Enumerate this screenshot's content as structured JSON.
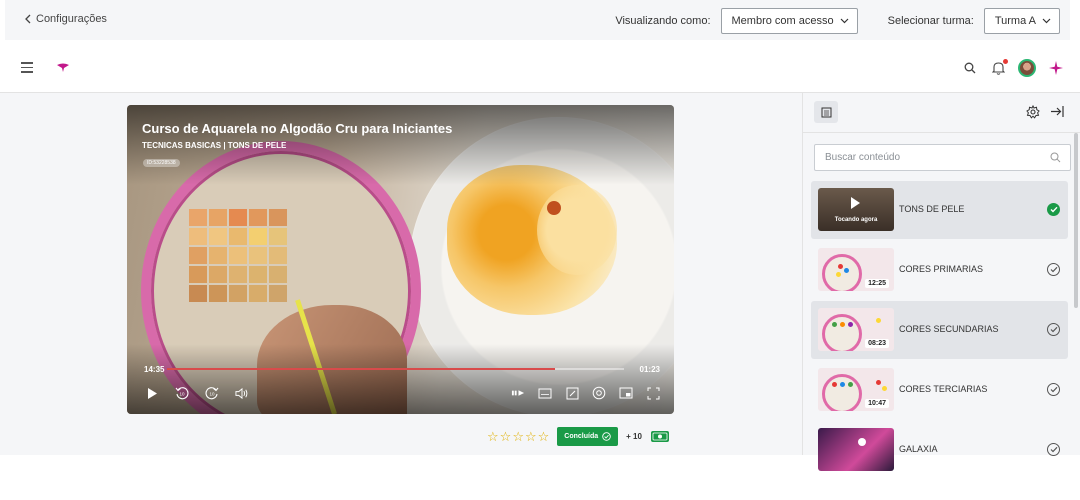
{
  "config_bar": {
    "back_label": "Configurações",
    "viewing_as_label": "Visualizando como:",
    "viewing_as_value": "Membro com acesso",
    "select_class_label": "Selecionar turma:",
    "select_class_value": "Turma A"
  },
  "header": {
    "icons": [
      "menu-icon",
      "logo",
      "search-icon",
      "bell-icon",
      "avatar",
      "sparkle-icon"
    ],
    "accent_color": "#c2188b"
  },
  "video": {
    "title": "Curso de Aquarela no Algodão Cru para Iniciantes",
    "subtitle": "TECNICAS BASICAS | TONS DE PELE",
    "id_badge": "ID:53228538",
    "time_current": "14:35",
    "time_remaining": "01:23",
    "progress": 0.85,
    "controls_left": [
      "play-icon",
      "rewind-10-icon",
      "forward-10-icon",
      "volume-icon"
    ],
    "controls_right": [
      "speed-icon",
      "subtitles-icon",
      "edit-icon",
      "record-icon",
      "pip-icon",
      "fullscreen-icon"
    ]
  },
  "below_video": {
    "rating_stars": 5,
    "rating_value": 0,
    "done_label": "Concluída",
    "points": "+ 10",
    "done_color": "#1a9a47"
  },
  "panel": {
    "search_placeholder": "Buscar conteúdo",
    "items": [
      {
        "title": "TONS DE PELE",
        "duration": "",
        "now_playing": "Tocando agora",
        "status": "completed-filled",
        "active": true
      },
      {
        "title": "CORES PRIMARIAS",
        "duration": "12:25",
        "status": "completed-outline",
        "active": false
      },
      {
        "title": "CORES SECUNDARIAS",
        "duration": "08:23",
        "status": "completed-outline",
        "active": true
      },
      {
        "title": "CORES TERCIARIAS",
        "duration": "10:47",
        "status": "completed-outline",
        "active": false
      },
      {
        "title": "GALAXIA",
        "duration": "",
        "status": "completed-outline",
        "active": false
      }
    ]
  }
}
